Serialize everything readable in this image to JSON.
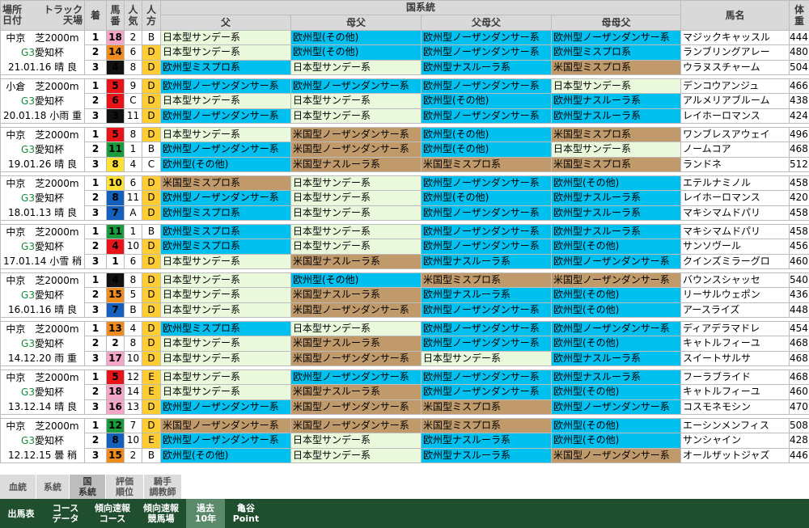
{
  "header": {
    "place_date": "場所\n日付",
    "track_weather": "トラック\n天場",
    "finish": "着",
    "number": "馬\n番",
    "popularity": "人\n気",
    "mark": "人\n方",
    "lineage_group": "国系統",
    "sire": "父",
    "dam_sire": "母父",
    "sire_dam_sire": "父母父",
    "dam_dam_sire": "母母父",
    "horse_name": "馬名",
    "weight": "体\n重"
  },
  "races": [
    {
      "place": "中京　芝2000m",
      "grade": "G3",
      "name": "愛知杯",
      "date": "21.01.16 晴 良",
      "rows": [
        {
          "rank": "1",
          "num": "18",
          "post": 8,
          "pop": "2",
          "mark": "B",
          "p": [
            [
              "日本型サンデー系",
              "j"
            ],
            [
              "欧州型(その他)",
              "e"
            ],
            [
              "欧州型ノーザンダンサー系",
              "e"
            ],
            [
              "欧州型ノーザンダンサー系",
              "e"
            ]
          ],
          "horse": "マジックキャッスル",
          "wt": "444"
        },
        {
          "rank": "2",
          "num": "14",
          "post": 7,
          "pop": "6",
          "mark": "D",
          "p": [
            [
              "日本型サンデー系",
              "j"
            ],
            [
              "欧州型(その他)",
              "e"
            ],
            [
              "欧州型ノーザンダンサー系",
              "e"
            ],
            [
              "欧州型ミスプロ系",
              "e"
            ]
          ],
          "horse": "ランブリングアレー",
          "wt": "480"
        },
        {
          "rank": "3",
          "num": "4",
          "post": 2,
          "pop": "8",
          "mark": "D",
          "p": [
            [
              "欧州型ミスプロ系",
              "e"
            ],
            [
              "日本型サンデー系",
              "j"
            ],
            [
              "欧州型ナスルーラ系",
              "e"
            ],
            [
              "米国型ミスプロ系",
              "a"
            ]
          ],
          "horse": "ウラヌスチャーム",
          "wt": "504"
        }
      ]
    },
    {
      "place": "小倉　芝2000m",
      "grade": "G3",
      "name": "愛知杯",
      "date": "20.01.18 小雨 重",
      "rows": [
        {
          "rank": "1",
          "num": "5",
          "post": 3,
          "pop": "9",
          "mark": "D",
          "p": [
            [
              "欧州型ノーザンダンサー系",
              "e"
            ],
            [
              "欧州型ノーザンダンサー系",
              "e"
            ],
            [
              "欧州型ノーザンダンサー系",
              "e"
            ],
            [
              "日本型サンデー系",
              "j"
            ]
          ],
          "horse": "デンコウアンジュ",
          "wt": "466"
        },
        {
          "rank": "2",
          "num": "6",
          "post": 3,
          "pop": "C",
          "mark": "D",
          "p": [
            [
              "日本型サンデー系",
              "j"
            ],
            [
              "日本型サンデー系",
              "j"
            ],
            [
              "欧州型(その他)",
              "e"
            ],
            [
              "欧州型ナスルーラ系",
              "e"
            ]
          ],
          "horse": "アルメリアブルーム",
          "wt": "438"
        },
        {
          "rank": "3",
          "num": "3",
          "post": 2,
          "pop": "11",
          "mark": "D",
          "p": [
            [
              "欧州型ノーザンダンサー系",
              "e"
            ],
            [
              "日本型サンデー系",
              "j"
            ],
            [
              "欧州型ノーザンダンサー系",
              "e"
            ],
            [
              "欧州型ナスルーラ系",
              "e"
            ]
          ],
          "horse": "レイホーロマンス",
          "wt": "424"
        }
      ]
    },
    {
      "place": "中京　芝2000m",
      "grade": "G3",
      "name": "愛知杯",
      "date": "19.01.26 晴 良",
      "rows": [
        {
          "rank": "1",
          "num": "5",
          "post": 3,
          "pop": "8",
          "mark": "D",
          "p": [
            [
              "日本型サンデー系",
              "j"
            ],
            [
              "米国型ノーザンダンサー系",
              "a"
            ],
            [
              "欧州型(その他)",
              "e"
            ],
            [
              "米国型ミスプロ系",
              "a"
            ]
          ],
          "horse": "ワンブレスアウェイ",
          "wt": "496"
        },
        {
          "rank": "2",
          "num": "11",
          "post": 6,
          "pop": "1",
          "mark": "B",
          "p": [
            [
              "欧州型ノーザンダンサー系",
              "e"
            ],
            [
              "米国型ノーザンダンサー系",
              "a"
            ],
            [
              "欧州型(その他)",
              "e"
            ],
            [
              "日本型サンデー系",
              "j"
            ]
          ],
          "horse": "ノームコア",
          "wt": "468"
        },
        {
          "rank": "3",
          "num": "8",
          "post": 5,
          "pop": "4",
          "mark": "C",
          "p": [
            [
              "欧州型(その他)",
              "e"
            ],
            [
              "米国型ナスルーラ系",
              "a"
            ],
            [
              "米国型ミスプロ系",
              "a"
            ],
            [
              "米国型ミスプロ系",
              "a"
            ]
          ],
          "horse": "ランドネ",
          "wt": "512"
        }
      ]
    },
    {
      "place": "中京　芝2000m",
      "grade": "G3",
      "name": "愛知杯",
      "date": "18.01.13 晴 良",
      "rows": [
        {
          "rank": "1",
          "num": "10",
          "post": 5,
          "pop": "6",
          "mark": "D",
          "p": [
            [
              "米国型ミスプロ系",
              "a"
            ],
            [
              "日本型サンデー系",
              "j"
            ],
            [
              "欧州型ノーザンダンサー系",
              "e"
            ],
            [
              "欧州型(その他)",
              "e"
            ]
          ],
          "horse": "エテルナミノル",
          "wt": "458"
        },
        {
          "rank": "2",
          "num": "8",
          "post": 4,
          "pop": "11",
          "mark": "D",
          "p": [
            [
              "欧州型ノーザンダンサー系",
              "e"
            ],
            [
              "日本型サンデー系",
              "j"
            ],
            [
              "欧州型(その他)",
              "e"
            ],
            [
              "欧州型ナスルーラ系",
              "e"
            ]
          ],
          "horse": "レイホーロマンス",
          "wt": "420"
        },
        {
          "rank": "3",
          "num": "7",
          "post": 4,
          "pop": "A",
          "mark": "D",
          "p": [
            [
              "欧州型ミスプロ系",
              "e"
            ],
            [
              "日本型サンデー系",
              "j"
            ],
            [
              "欧州型ノーザンダンサー系",
              "e"
            ],
            [
              "欧州型ナスルーラ系",
              "e"
            ]
          ],
          "horse": "マキシマムドパリ",
          "wt": "458"
        }
      ]
    },
    {
      "place": "中京　芝2000m",
      "grade": "G3",
      "name": "愛知杯",
      "date": "17.01.14 小雪 稍",
      "rows": [
        {
          "rank": "1",
          "num": "11",
          "post": 6,
          "pop": "1",
          "mark": "B",
          "p": [
            [
              "欧州型ミスプロ系",
              "e"
            ],
            [
              "日本型サンデー系",
              "j"
            ],
            [
              "欧州型ノーザンダンサー系",
              "e"
            ],
            [
              "欧州型ナスルーラ系",
              "e"
            ]
          ],
          "horse": "マキシマムドパリ",
          "wt": "458"
        },
        {
          "rank": "2",
          "num": "4",
          "post": 3,
          "pop": "10",
          "mark": "D",
          "p": [
            [
              "欧州型ミスプロ系",
              "e"
            ],
            [
              "日本型サンデー系",
              "j"
            ],
            [
              "欧州型ノーザンダンサー系",
              "e"
            ],
            [
              "欧州型(その他)",
              "e"
            ]
          ],
          "horse": "サンソヴール",
          "wt": "456"
        },
        {
          "rank": "3",
          "num": "1",
          "post": 1,
          "pop": "6",
          "mark": "D",
          "p": [
            [
              "日本型サンデー系",
              "j"
            ],
            [
              "米国型ナスルーラ系",
              "a"
            ],
            [
              "欧州型ナスルーラ系",
              "e"
            ],
            [
              "欧州型ノーザンダンサー系",
              "e"
            ]
          ],
          "horse": "クインズミラーグロ",
          "wt": "460"
        }
      ]
    },
    {
      "place": "中京　芝2000m",
      "grade": "G3",
      "name": "愛知杯",
      "date": "16.01.16 晴 良",
      "rows": [
        {
          "rank": "1",
          "num": "4",
          "post": 2,
          "pop": "8",
          "mark": "D",
          "p": [
            [
              "日本型サンデー系",
              "j"
            ],
            [
              "欧州型(その他)",
              "e"
            ],
            [
              "米国型ミスプロ系",
              "a"
            ],
            [
              "米国型ノーザンダンサー系",
              "a"
            ]
          ],
          "horse": "バウンスシャッセ",
          "wt": "540"
        },
        {
          "rank": "2",
          "num": "15",
          "post": 7,
          "pop": "5",
          "mark": "D",
          "p": [
            [
              "日本型サンデー系",
              "j"
            ],
            [
              "米国型ナスルーラ系",
              "a"
            ],
            [
              "欧州型ナスルーラ系",
              "e"
            ],
            [
              "欧州型(その他)",
              "e"
            ]
          ],
          "horse": "リーサルウェポン",
          "wt": "436"
        },
        {
          "rank": "3",
          "num": "7",
          "post": 4,
          "pop": "B",
          "mark": "D",
          "p": [
            [
              "日本型サンデー系",
              "j"
            ],
            [
              "米国型ノーザンダンサー系",
              "a"
            ],
            [
              "欧州型ノーザンダンサー系",
              "e"
            ],
            [
              "欧州型(その他)",
              "e"
            ]
          ],
          "horse": "アースライズ",
          "wt": "448"
        }
      ]
    },
    {
      "place": "中京　芝2000m",
      "grade": "G3",
      "name": "愛知杯",
      "date": "14.12.20 雨 重",
      "rows": [
        {
          "rank": "1",
          "num": "13",
          "post": 7,
          "pop": "4",
          "mark": "D",
          "p": [
            [
              "欧州型ミスプロ系",
              "e"
            ],
            [
              "日本型サンデー系",
              "j"
            ],
            [
              "欧州型ノーザンダンサー系",
              "e"
            ],
            [
              "欧州型ノーザンダンサー系",
              "e"
            ]
          ],
          "horse": "ディアデラマドレ",
          "wt": "454"
        },
        {
          "rank": "2",
          "num": "2",
          "post": 1,
          "pop": "8",
          "mark": "D",
          "p": [
            [
              "日本型サンデー系",
              "j"
            ],
            [
              "米国型ナスルーラ系",
              "a"
            ],
            [
              "欧州型ノーザンダンサー系",
              "e"
            ],
            [
              "欧州型(その他)",
              "e"
            ]
          ],
          "horse": "キャトルフィーユ",
          "wt": "468"
        },
        {
          "rank": "3",
          "num": "17",
          "post": 8,
          "pop": "10",
          "mark": "D",
          "p": [
            [
              "日本型サンデー系",
              "j"
            ],
            [
              "米国型ノーザンダンサー系",
              "a"
            ],
            [
              "日本型サンデー系",
              "j"
            ],
            [
              "欧州型ナスルーラ系",
              "e"
            ]
          ],
          "horse": "スイートサルサ",
          "wt": "468"
        }
      ]
    },
    {
      "place": "中京　芝2000m",
      "grade": "G3",
      "name": "愛知杯",
      "date": "13.12.14 晴 良",
      "rows": [
        {
          "rank": "1",
          "num": "5",
          "post": 3,
          "pop": "12",
          "mark": "E",
          "p": [
            [
              "日本型サンデー系",
              "j"
            ],
            [
              "欧州型ノーザンダンサー系",
              "e"
            ],
            [
              "欧州型ノーザンダンサー系",
              "e"
            ],
            [
              "欧州型ナスルーラ系",
              "e"
            ]
          ],
          "horse": "フーラブライド",
          "wt": "468"
        },
        {
          "rank": "2",
          "num": "18",
          "post": 8,
          "pop": "14",
          "mark": "E",
          "p": [
            [
              "日本型サンデー系",
              "j"
            ],
            [
              "米国型ナスルーラ系",
              "a"
            ],
            [
              "欧州型ノーザンダンサー系",
              "e"
            ],
            [
              "欧州型(その他)",
              "e"
            ]
          ],
          "horse": "キャトルフィーユ",
          "wt": "460"
        },
        {
          "rank": "3",
          "num": "16",
          "post": 8,
          "pop": "13",
          "mark": "D",
          "p": [
            [
              "欧州型ノーザンダンサー系",
              "e"
            ],
            [
              "米国型ノーザンダンサー系",
              "a"
            ],
            [
              "米国型ミスプロ系",
              "a"
            ],
            [
              "欧州型ノーザンダンサー系",
              "e"
            ]
          ],
          "horse": "コスモネモシン",
          "wt": "470"
        }
      ]
    },
    {
      "place": "中京　芝2000m",
      "grade": "G3",
      "name": "愛知杯",
      "date": "12.12.15 曇 稍",
      "rows": [
        {
          "rank": "1",
          "num": "12",
          "post": 6,
          "pop": "7",
          "mark": "D",
          "p": [
            [
              "米国型ノーザンダンサー系",
              "a"
            ],
            [
              "米国型ノーザンダンサー系",
              "a"
            ],
            [
              "米国型ミスプロ系",
              "a"
            ],
            [
              "欧州型(その他)",
              "e"
            ]
          ],
          "horse": "エーシンメンフィス",
          "wt": "508"
        },
        {
          "rank": "2",
          "num": "8",
          "post": 4,
          "pop": "10",
          "mark": "E",
          "p": [
            [
              "欧州型ノーザンダンサー系",
              "e"
            ],
            [
              "日本型サンデー系",
              "j"
            ],
            [
              "欧州型ナスルーラ系",
              "e"
            ],
            [
              "欧州型(その他)",
              "e"
            ]
          ],
          "horse": "サンシャイン",
          "wt": "428"
        },
        {
          "rank": "3",
          "num": "15",
          "post": 7,
          "pop": "2",
          "mark": "B",
          "p": [
            [
              "欧州型(その他)",
              "e"
            ],
            [
              "日本型サンデー系",
              "j"
            ],
            [
              "欧州型ナスルーラ系",
              "e"
            ],
            [
              "米国型ノーザンダンサー系",
              "a"
            ]
          ],
          "horse": "オールザットジャズ",
          "wt": "446"
        }
      ]
    }
  ],
  "tabs": [
    {
      "label": "血統",
      "active": false
    },
    {
      "label": "系統",
      "active": false
    },
    {
      "label": "国\n系統",
      "active": true
    },
    {
      "label": "評価\n順位",
      "active": false
    },
    {
      "label": "騎手\n調教師",
      "active": false
    }
  ],
  "bottom_tabs": [
    {
      "label": "出馬表",
      "active": false
    },
    {
      "label": "コース\nデータ",
      "active": false
    },
    {
      "label": "傾向速報\nコース",
      "active": false
    },
    {
      "label": "傾向速報\n競馬場",
      "active": false
    },
    {
      "label": "過去\n10年",
      "active": true
    },
    {
      "label": "亀谷\nPoint",
      "active": false
    }
  ],
  "colors": {
    "japan_sunday": "#eaf8dc",
    "europe": "#00c0f0",
    "america": "#c19a6b",
    "mark_bg": "#ffcc33",
    "footer_bg": "#1f4f2f"
  }
}
